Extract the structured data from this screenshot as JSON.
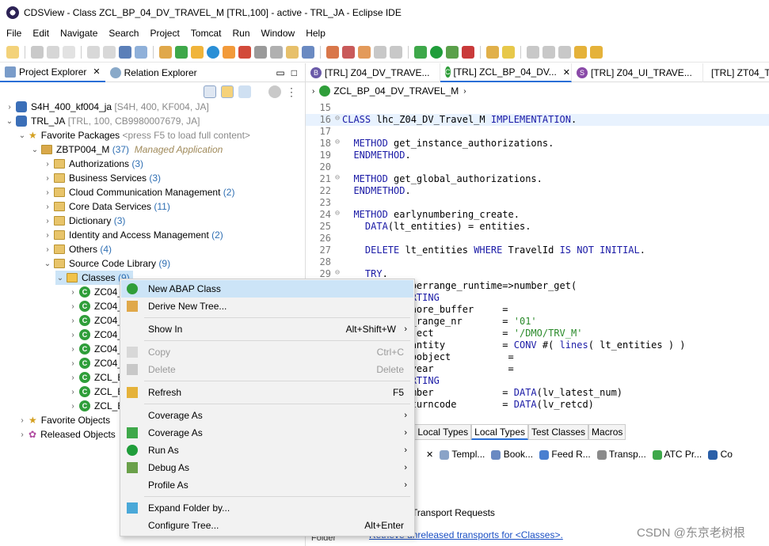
{
  "window": {
    "title": "CDSView - Class ZCL_BP_04_DV_TRAVEL_M [TRL,100] - active - TRL_JA - Eclipse IDE"
  },
  "menu": [
    "File",
    "Edit",
    "Navigate",
    "Search",
    "Project",
    "Tomcat",
    "Run",
    "Window",
    "Help"
  ],
  "left_tabs": [
    {
      "label": "Project Explorer",
      "close": "✕"
    },
    {
      "label": "Relation Explorer"
    }
  ],
  "tree": {
    "s4h": {
      "name": "S4H_400_kf004_ja",
      "meta": "[S4H, 400, KF004, JA]"
    },
    "trl": {
      "name": "TRL_JA",
      "meta": "[TRL, 100, CB9980007679, JA]"
    },
    "fav_pkgs": {
      "name": "Favorite Packages",
      "hint": "<press F5 to load full content>"
    },
    "zbtp": {
      "name": "ZBTP004_M",
      "count": "(37)",
      "desc": "Managed Application"
    },
    "folders": [
      {
        "name": "Authorizations",
        "count": "(3)"
      },
      {
        "name": "Business Services",
        "count": "(3)"
      },
      {
        "name": "Cloud Communication Management",
        "count": "(2)"
      },
      {
        "name": "Core Data Services",
        "count": "(11)"
      },
      {
        "name": "Dictionary",
        "count": "(3)"
      },
      {
        "name": "Identity and Access Management",
        "count": "(2)"
      },
      {
        "name": "Others",
        "count": "(4)"
      },
      {
        "name": "Source Code Library",
        "count": "(9)"
      }
    ],
    "classes": {
      "name": "Classes",
      "count": "(9)"
    },
    "class_items": [
      "ZC04_",
      "ZC04_",
      "ZC04_",
      "ZC04_",
      "ZC04_",
      "ZC04_",
      "ZCL_B",
      "ZCL_B",
      "ZCL_B"
    ],
    "fav_objects": "Favorite Objects",
    "released": "Released Objects"
  },
  "editor_tabs": [
    {
      "label": "[TRL] Z04_DV_TRAVE...",
      "icon": "B"
    },
    {
      "label": "[TRL] ZCL_BP_04_DV...",
      "icon": "C",
      "close": "✕",
      "active": true
    },
    {
      "label": "[TRL] Z04_UI_TRAVE...",
      "icon": "S"
    },
    {
      "label": "[TRL] ZT04_T",
      "icon": "T"
    }
  ],
  "breadcrumb": "ZCL_BP_04_DV_TRAVEL_M",
  "code": [
    {
      "n": "15",
      "t": ""
    },
    {
      "n": "16",
      "f": "⊖",
      "t": "CLASS lhc_Z04_DV_Travel_M IMPLEMENTATION."
    },
    {
      "n": "17",
      "t": ""
    },
    {
      "n": "18",
      "f": "⊖",
      "t": "  METHOD get_instance_authorizations."
    },
    {
      "n": "19",
      "t": "  ENDMETHOD."
    },
    {
      "n": "20",
      "t": ""
    },
    {
      "n": "21",
      "f": "⊖",
      "t": "  METHOD get_global_authorizations."
    },
    {
      "n": "22",
      "t": "  ENDMETHOD."
    },
    {
      "n": "23",
      "t": ""
    },
    {
      "n": "24",
      "f": "⊖",
      "t": "  METHOD earlynumbering_create."
    },
    {
      "n": "25",
      "t": "    DATA(lt_entities) = entities."
    },
    {
      "n": "26",
      "t": ""
    },
    {
      "n": "27",
      "t": "    DELETE lt_entities WHERE TravelId IS NOT INITIAL."
    },
    {
      "n": "28",
      "t": ""
    },
    {
      "n": "29",
      "f": "⊖",
      "t": "    TRY."
    },
    {
      "n": "",
      "t": "      cl_numberrange_runtime=>number_get("
    },
    {
      "n": "",
      "t": "        EXPORTING"
    },
    {
      "n": "",
      "t": "          ignore_buffer     ="
    },
    {
      "n": "",
      "t": "          nr_range_nr       = '01'"
    },
    {
      "n": "",
      "t": "          object            = '/DMO/TRV_M'"
    },
    {
      "n": "",
      "t": "          quantity          = CONV #( lines( lt_entities ) )"
    },
    {
      "n": "",
      "t": "          subobject          ="
    },
    {
      "n": "",
      "t": "          toyear             ="
    },
    {
      "n": "",
      "t": "        IMPORTING"
    },
    {
      "n": "",
      "t": "          number            = DATA(lv_latest_num)"
    },
    {
      "n": "",
      "t": "          returncode        = DATA(lv_retcd)"
    }
  ],
  "bottom_tabs": [
    "nt Local Types",
    "Local Types",
    "Test Classes",
    "Macros"
  ],
  "view_tabs": [
    "Templ...",
    "Book...",
    "Feed R...",
    "Transp...",
    "ATC Pr...",
    "Co"
  ],
  "transport": {
    "title": "Transport Requests",
    "link": "Retrieve unreleased transports for <Classes>.",
    "folder_label": "Folder"
  },
  "context_menu": [
    {
      "label": "New ABAP Class",
      "icon": "new-class-icon",
      "selected": true
    },
    {
      "label": "Derive New Tree...",
      "icon": "derive-tree-icon"
    },
    {
      "sep": true
    },
    {
      "label": "Show In",
      "shortcut": "Alt+Shift+W",
      "submenu": true
    },
    {
      "sep": true
    },
    {
      "label": "Copy",
      "shortcut": "Ctrl+C",
      "disabled": true,
      "icon": "copy-icon"
    },
    {
      "label": "Delete",
      "shortcut": "Delete",
      "disabled": true,
      "icon": "delete-icon"
    },
    {
      "sep": true
    },
    {
      "label": "Refresh",
      "shortcut": "F5",
      "icon": "refresh-icon"
    },
    {
      "sep": true
    },
    {
      "label": "Coverage As",
      "submenu": true
    },
    {
      "label": "Coverage As",
      "submenu": true,
      "icon": "coverage-icon"
    },
    {
      "label": "Run As",
      "submenu": true,
      "icon": "run-icon"
    },
    {
      "label": "Debug As",
      "submenu": true,
      "icon": "debug-icon"
    },
    {
      "label": "Profile As",
      "submenu": true
    },
    {
      "sep": true
    },
    {
      "label": "Expand Folder by...",
      "icon": "expand-folder-icon"
    },
    {
      "label": "Configure Tree...",
      "shortcut": "Alt+Enter"
    }
  ],
  "watermark": "CSDN @东京老树根",
  "colors": {
    "accent": "#2a6fd6",
    "selection": "#cce4f7",
    "keyword": "#1a1aa6",
    "string": "#2a8a2a"
  }
}
